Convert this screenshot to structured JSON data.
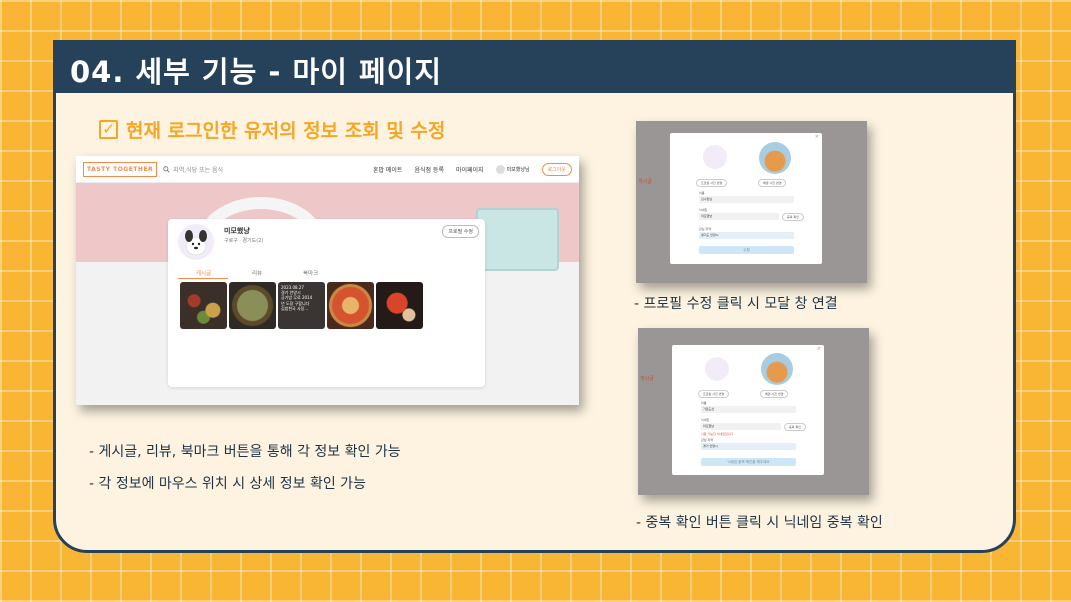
{
  "slide": {
    "title": "04. 세부 기능 - 마이 페이지",
    "subtitle": "현재 로그인한 유저의 정보 조회 및 수정",
    "check_glyph": "✓",
    "captions": {
      "left_1": "- 게시글, 리뷰, 북마크 버튼을 통해 각 정보 확인 가능",
      "left_2": "- 각 정보에 마우스 위치 시 상세 정보 확인 가능",
      "right_top": "- 프로필 수정 클릭 시 모달 창 연결",
      "right_bottom": "- 중복 확인 버튼 클릭 시 닉네임 중복 확인"
    }
  },
  "mock_app": {
    "logo_text": "TASTY TOGETHER",
    "search_placeholder": "지역,식당 또는 음식",
    "nav": [
      "혼밥 메이트",
      "음식점 등록",
      "마이페이지"
    ],
    "user_name": "미모했냥님",
    "logout_label": "로그아웃",
    "profile": {
      "name": "미모했냥",
      "region": "구로구ㆍ경기도(2)",
      "edit_label": "프로필 수정"
    },
    "tabs": [
      "게시글",
      "리뷰",
      "북마크"
    ],
    "active_tab": "게시글",
    "thumb_overlay_text": "2023.08.27\n경기 안양시\n공기밥 무료 2014\n년 도장 구합니다\n김밥천국 사장..."
  },
  "modal_top": {
    "left_avatar_btn": "프로필 사진 변경",
    "right_avatar_btn": "배경 사진 변경",
    "label_1": "이름",
    "value_1": "김수환님",
    "label_2": "닉네임",
    "value_2": "미모했냥",
    "check_btn": "중복 확인",
    "label_3": "관심 지역",
    "value_3": "경기도 안양시",
    "submit": "수정",
    "side_label": "게시글"
  },
  "modal_bottom": {
    "left_avatar_btn": "프로필 사진 변경",
    "right_avatar_btn": "배경 사진 변경",
    "label_1": "이름",
    "value_1": "가운도선",
    "label_2": "닉네임",
    "value_2": "미모했냥",
    "check_btn": "중복 확인",
    "error_text": "사용 가능한 닉네임입니다",
    "label_3": "관심 지역",
    "value_3": "경기 안양시",
    "submit": "닉네임 중복 확인을 해주세요",
    "side_label": "게시글"
  },
  "colors": {
    "background": "#f9b534",
    "header": "#26425a",
    "accent": "#f5a623",
    "brand": "#f28b4b"
  }
}
